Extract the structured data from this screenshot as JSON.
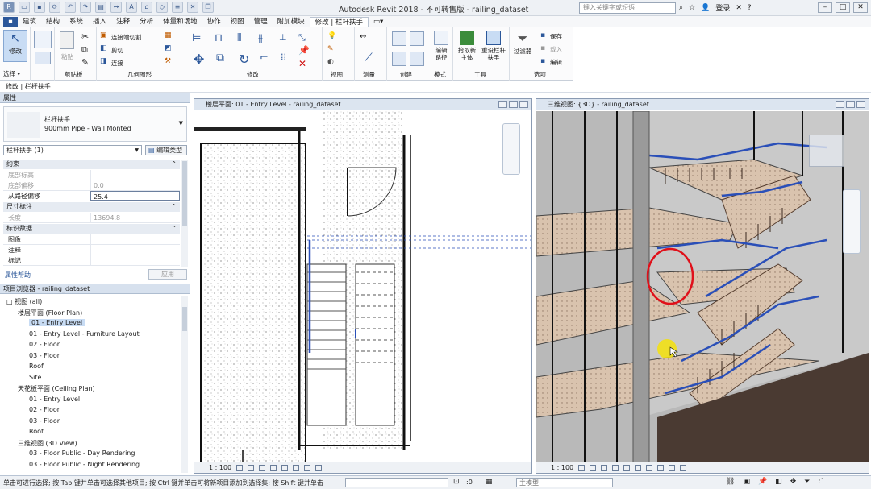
{
  "app_title": "Autodesk Revit 2018 -   不可转售版 -       railing_dataset",
  "search_placeholder": "键入关键字或短语",
  "login": "登录",
  "menus": [
    "建筑",
    "结构",
    "系统",
    "插入",
    "注释",
    "分析",
    "体量和场地",
    "协作",
    "视图",
    "管理",
    "附加模块",
    "修改 | 栏杆扶手"
  ],
  "ribbon": {
    "modify_label": "修改",
    "groups": [
      "选择",
      "属性",
      "剪贴板",
      "几何图形",
      "修改",
      "视图",
      "测量",
      "创建",
      "模式",
      "工具",
      "选项"
    ],
    "items": {
      "connect_cut": "连接端切割",
      "cut": "剪切",
      "join": "连接",
      "edit_path": "编辑路径",
      "pick_host": "拾取新主体",
      "reset_railing": "重设栏杆扶手",
      "filter": "过滤器",
      "save": "保存",
      "load": "载入",
      "edit": "编辑",
      "select_dropdown": "选择 ▾",
      "props_btn": "属性",
      "paste": "粘贴"
    }
  },
  "context_label": "修改 | 栏杆扶手",
  "properties": {
    "header": "属性",
    "type_name": "栏杆扶手",
    "type_sub": "900mm Pipe - Wall Monted",
    "instance": "栏杆扶手 (1)",
    "edit_type": "编辑类型",
    "sections": {
      "constraints": "约束",
      "dimensions": "尺寸标注",
      "identity": "标识数据"
    },
    "rows": {
      "base_level": {
        "k": "底部标高",
        "v": ""
      },
      "base_offset": {
        "k": "底部偏移",
        "v": "0.0"
      },
      "path_offset": {
        "k": "从路径偏移",
        "v": "25.4"
      },
      "length": {
        "k": "长度",
        "v": "13694.8"
      },
      "image": {
        "k": "图像",
        "v": ""
      },
      "comments": {
        "k": "注释",
        "v": ""
      },
      "mark": {
        "k": "标记",
        "v": ""
      }
    },
    "help": "属性帮助",
    "apply": "应用"
  },
  "browser": {
    "header": "项目浏览器 - railing_dataset",
    "items": [
      {
        "text": "□  视图 (all)",
        "indent": 0,
        "selected": false
      },
      {
        "text": "楼层平面 (Floor Plan)",
        "indent": 1,
        "selected": false
      },
      {
        "text": "01 - Entry Level",
        "indent": 2,
        "selected": true
      },
      {
        "text": "01 - Entry Level - Furniture Layout",
        "indent": 2,
        "selected": false
      },
      {
        "text": "02 - Floor",
        "indent": 2,
        "selected": false
      },
      {
        "text": "03 - Floor",
        "indent": 2,
        "selected": false
      },
      {
        "text": "Roof",
        "indent": 2,
        "selected": false
      },
      {
        "text": "Site",
        "indent": 2,
        "selected": false
      },
      {
        "text": "天花板平面 (Ceiling Plan)",
        "indent": 1,
        "selected": false
      },
      {
        "text": "01 - Entry Level",
        "indent": 2,
        "selected": false
      },
      {
        "text": "02 - Floor",
        "indent": 2,
        "selected": false
      },
      {
        "text": "03 - Floor",
        "indent": 2,
        "selected": false
      },
      {
        "text": "Roof",
        "indent": 2,
        "selected": false
      },
      {
        "text": "三维视图 (3D View)",
        "indent": 1,
        "selected": false
      },
      {
        "text": "03 - Floor Public - Day Rendering",
        "indent": 2,
        "selected": false
      },
      {
        "text": "03 - Floor Public - Night Rendering",
        "indent": 2,
        "selected": false
      }
    ]
  },
  "plan_view": {
    "title": "楼层平面: 01 - Entry Level - railing_dataset",
    "scale": "1 : 100"
  },
  "view3d": {
    "title": "三维视图: {3D} - railing_dataset",
    "scale": "1 : 100"
  },
  "statusbar": {
    "hint": "单击可进行选择; 按 Tab 键并单击可选择其他项目; 按 Ctrl 键并单击可将新项目添加到选择集; 按 Shift 键并单击",
    "zero": ":0",
    "model": "主模型"
  },
  "colors": {
    "accent": "#2b579a",
    "selected": "#c8dcf4",
    "railing": "#2a4fb8",
    "highlight_circle": "#e0101a",
    "cursor": "#f5e20a"
  }
}
